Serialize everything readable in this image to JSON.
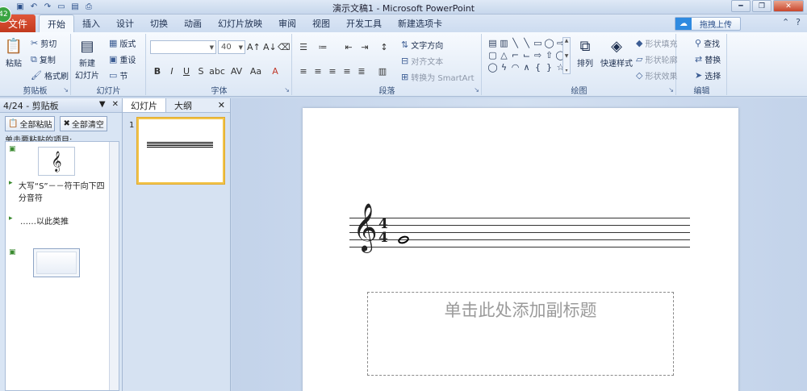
{
  "titlebar": {
    "title": "演示文稿1 - Microsoft PowerPoint",
    "qat_icons": [
      "save-icon",
      "undo-icon",
      "redo-icon",
      "new-icon",
      "open-icon",
      "print-icon"
    ]
  },
  "badge": "42",
  "tabs": {
    "file": "文件",
    "items": [
      "开始",
      "插入",
      "设计",
      "切换",
      "动画",
      "幻灯片放映",
      "审阅",
      "视图",
      "开发工具",
      "新建选项卡"
    ],
    "active": "开始"
  },
  "upload_button": "拖拽上传",
  "ribbon": {
    "clipboard": {
      "label": "剪贴板",
      "paste": "粘贴",
      "cut": "剪切",
      "copy": "复制",
      "format_painter": "格式刷"
    },
    "slides": {
      "label": "幻灯片",
      "new_slide": "新建",
      "new_slide2": "幻灯片",
      "layout": "版式",
      "reset": "重设",
      "section": "节"
    },
    "font": {
      "label": "字体",
      "font_name": "",
      "font_size": "40",
      "bold": "B",
      "italic": "I",
      "underline": "U",
      "strike": "S",
      "shadow": "abc",
      "spacing": "AV",
      "case": "Aa"
    },
    "paragraph": {
      "label": "段落",
      "text_direction": "文字方向",
      "align_text": "对齐文本",
      "smartart": "转换为 SmartArt"
    },
    "drawing": {
      "label": "绘图",
      "arrange": "排列",
      "quick_styles": "快速样式",
      "shape_fill": "形状填充",
      "shape_outline": "形状轮廓",
      "shape_effects": "形状效果"
    },
    "editing": {
      "label": "编辑",
      "find": "查找",
      "replace": "替换",
      "select": "选择"
    }
  },
  "clipboard_pane": {
    "title": "4/24 - 剪贴板",
    "paste_all": "全部粘贴",
    "clear_all": "全部清空",
    "instruction": "单击要粘贴的项目:",
    "items": [
      {
        "type": "image",
        "content": "𝄞"
      },
      {
        "type": "text",
        "content": "大写“S”－－符干向下四分音符"
      },
      {
        "type": "text",
        "content": "……以此类推"
      },
      {
        "type": "slide",
        "content": ""
      }
    ]
  },
  "slides_pane": {
    "tab_slides": "幻灯片",
    "tab_outline": "大纲",
    "thumb_number": "1"
  },
  "slide": {
    "clef": "𝄞",
    "time_sig_top": "4",
    "time_sig_bottom": "4",
    "subtitle_placeholder": "单击此处添加副标题"
  }
}
